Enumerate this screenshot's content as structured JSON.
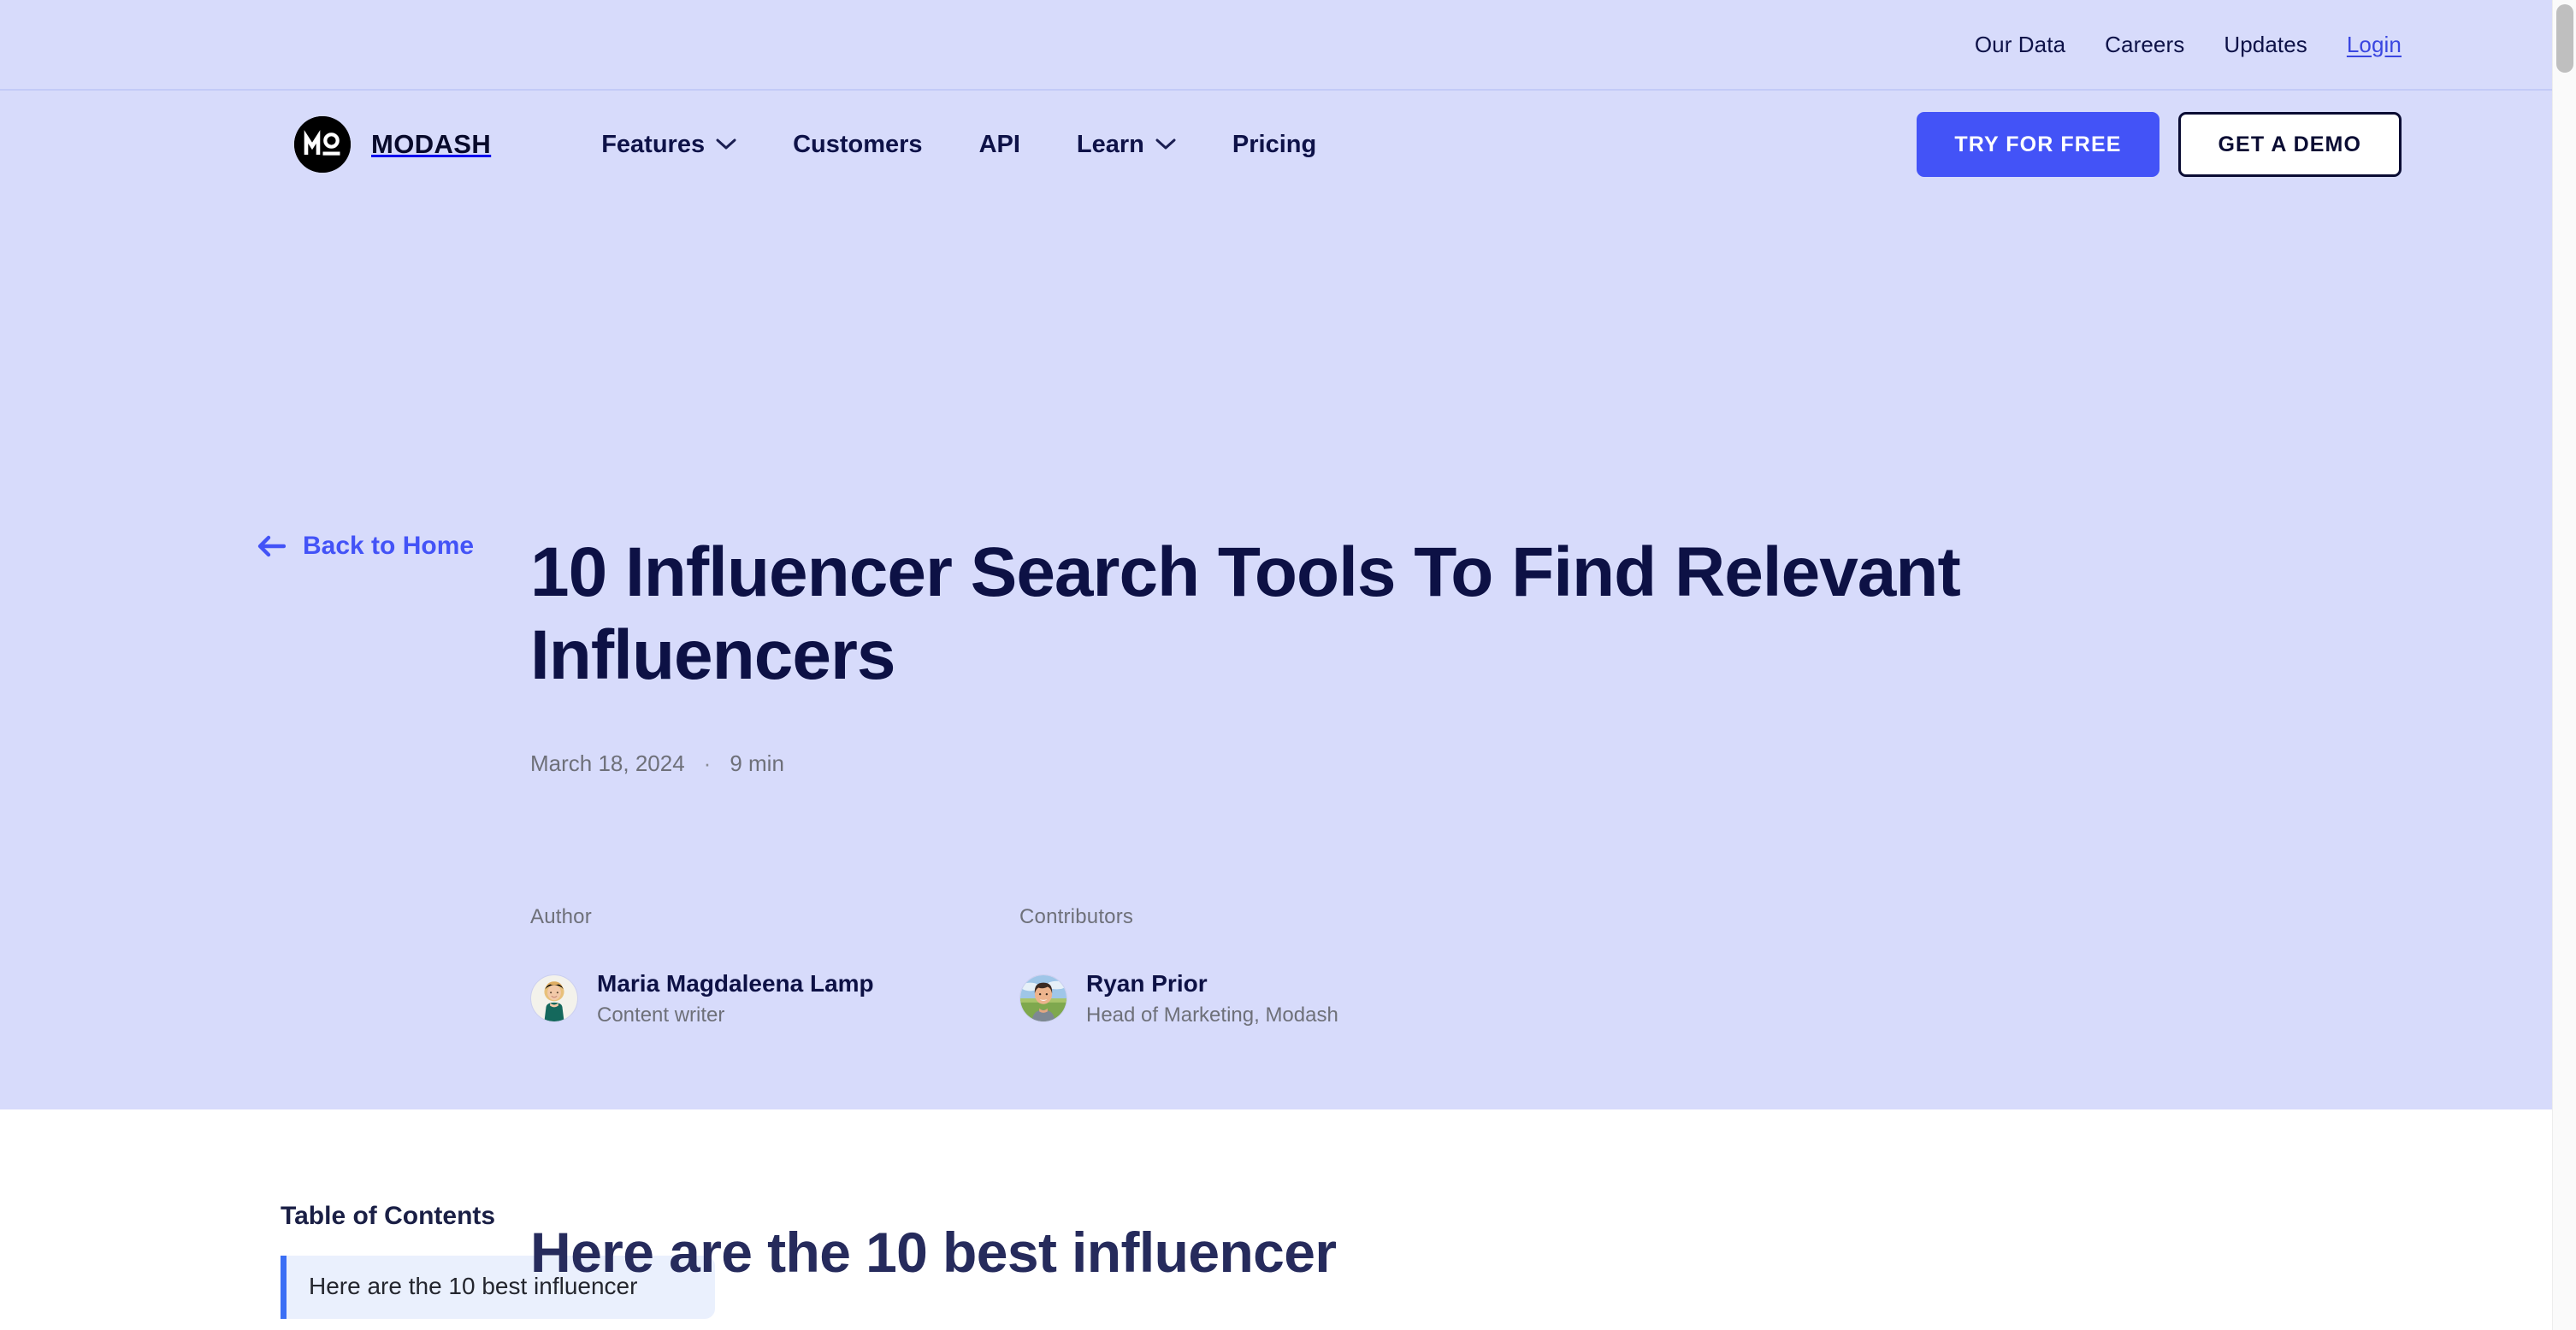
{
  "colors": {
    "hero_bg": "#D7DBFB",
    "accent_blue": "#4353F7",
    "link_blue": "#3A46E0",
    "title_navy": "#0D1145",
    "muted_gray": "#6E7079",
    "toc_bg": "#EAF0FD",
    "toc_bar": "#3B6FF5"
  },
  "utility_nav": {
    "items": [
      {
        "label": "Our Data",
        "style": "plain"
      },
      {
        "label": "Careers",
        "style": "plain"
      },
      {
        "label": "Updates",
        "style": "plain"
      },
      {
        "label": "Login",
        "style": "link"
      }
    ]
  },
  "header": {
    "brand_name": "MODASH",
    "logo_icon": "modash-logo-icon",
    "nav": [
      {
        "label": "Features",
        "has_dropdown": true,
        "icon": "chevron-down-icon"
      },
      {
        "label": "Customers",
        "has_dropdown": false,
        "icon": ""
      },
      {
        "label": "API",
        "has_dropdown": false,
        "icon": ""
      },
      {
        "label": "Learn",
        "has_dropdown": true,
        "icon": "chevron-down-icon"
      },
      {
        "label": "Pricing",
        "has_dropdown": false,
        "icon": ""
      }
    ],
    "cta_primary": "TRY FOR FREE",
    "cta_secondary": "GET A DEMO"
  },
  "hero": {
    "back_link": "Back to Home",
    "back_icon": "arrow-left-icon",
    "title": "10 Influencer Search Tools To Find Relevant Influencers",
    "date": "March 18, 2024",
    "separator": "·",
    "read_time": "9 min",
    "author": {
      "label": "Author",
      "name": "Maria Magdaleena Lamp",
      "role": "Content writer",
      "avatar_icon": "author-avatar"
    },
    "contributors": {
      "label": "Contributors",
      "name": "Ryan Prior",
      "role": "Head of Marketing, Modash",
      "avatar_icon": "contributor-avatar"
    }
  },
  "article": {
    "toc_title": "Table of Contents",
    "toc_items": [
      {
        "label": "Here are the 10 best influencer",
        "active": true
      }
    ],
    "heading": "Here are the 10 best influencer"
  },
  "scrollbar": {
    "name": "page-scrollbar"
  }
}
